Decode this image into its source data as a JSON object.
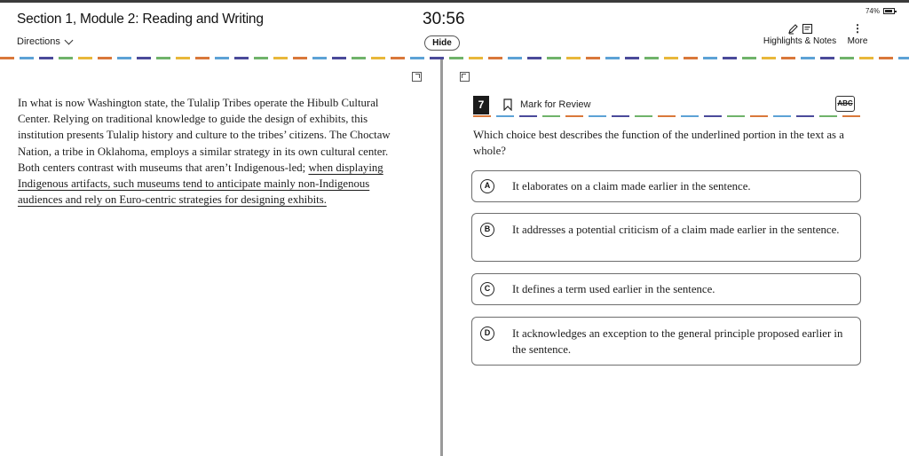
{
  "header": {
    "section_title": "Section 1, Module 2: Reading and Writing",
    "directions_label": "Directions",
    "timer": "30:56",
    "hide_label": "Hide",
    "battery_percent": "74%",
    "highlights_label": "Highlights & Notes",
    "more_label": "More",
    "icons": [
      "pencil-icon",
      "note-icon",
      "more-vertical-icon",
      "battery-icon",
      "chevron-down-icon"
    ]
  },
  "passage": {
    "text_before": "In what is now Washington state, the Tulalip Tribes operate the Hibulb Cultural Center. Relying on traditional knowledge to guide the design of exhibits, this institution presents Tulalip history and culture to the tribes’ citizens. The Choctaw Nation, a tribe in Oklahoma, employs a similar strategy in its own cultural center. Both centers contrast with museums that aren’t Indigenous-led; ",
    "underlined": "when displaying Indigenous artifacts, such museums tend to anticipate mainly non-Indigenous audiences and rely on Euro-centric strategies for designing exhibits."
  },
  "question": {
    "number": "7",
    "mark_label": "Mark for Review",
    "abc_label": "ABC",
    "prompt": "Which choice best describes the function of the underlined portion in the text as a whole?",
    "choices": [
      {
        "letter": "A",
        "text": "It elaborates on a claim made earlier in the sentence."
      },
      {
        "letter": "B",
        "text": "It addresses a potential criticism of a claim made earlier in the sentence."
      },
      {
        "letter": "C",
        "text": "It defines a term used earlier in the sentence."
      },
      {
        "letter": "D",
        "text": "It acknowledges an exception to the general principle proposed earlier in the sentence."
      }
    ]
  }
}
